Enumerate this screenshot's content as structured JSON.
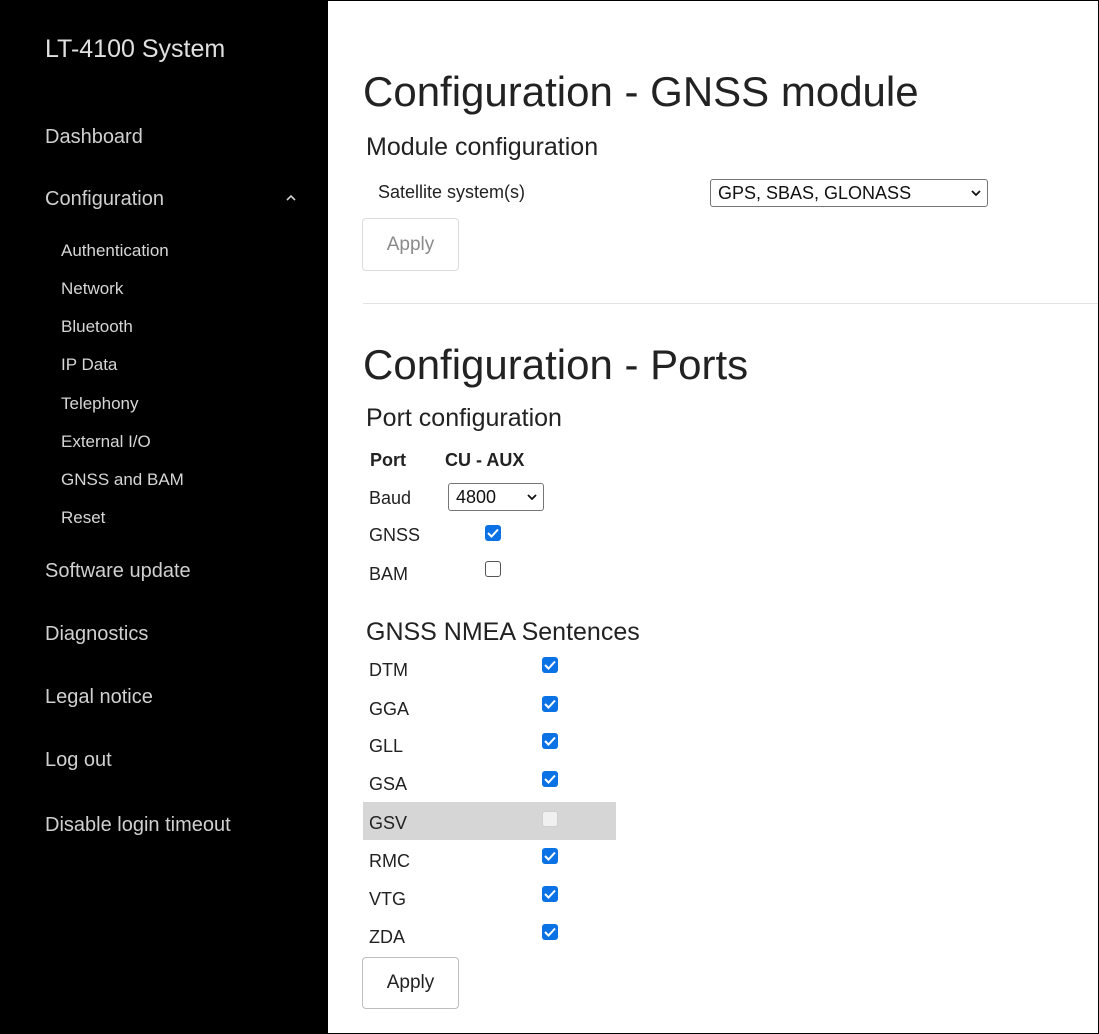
{
  "sidebar": {
    "brand": "LT-4100 System",
    "items": {
      "dashboard": "Dashboard",
      "configuration": "Configuration",
      "software_update": "Software update",
      "diagnostics": "Diagnostics",
      "legal_notice": "Legal notice",
      "log_out": "Log out",
      "disable_login_timeout": "Disable login timeout"
    },
    "config_sub": {
      "authentication": "Authentication",
      "network": "Network",
      "bluetooth": "Bluetooth",
      "ip_data": "IP Data",
      "telephony": "Telephony",
      "external_io": "External I/O",
      "gnss_bam": "GNSS and BAM",
      "reset": "Reset"
    },
    "expanded_icon": "chevron-up-icon"
  },
  "gnss": {
    "title": "Configuration - GNSS module",
    "section": "Module configuration",
    "satellite_label": "Satellite system(s)",
    "satellite_value": "GPS, SBAS, GLONASS",
    "apply": "Apply"
  },
  "ports": {
    "title": "Configuration - Ports",
    "section": "Port configuration",
    "header_port": "Port",
    "header_cu_aux": "CU - AUX",
    "baud_label": "Baud",
    "baud_value": "4800",
    "gnss_label": "GNSS",
    "gnss_checked": true,
    "bam_label": "BAM",
    "bam_checked": false
  },
  "nmea": {
    "title": "GNSS NMEA Sentences",
    "sentences": {
      "dtm": "DTM",
      "gga": "GGA",
      "gll": "GLL",
      "gsa": "GSA",
      "gsv": "GSV",
      "rmc": "RMC",
      "vtg": "VTG",
      "zda": "ZDA"
    },
    "checked": {
      "dtm": true,
      "gga": true,
      "gll": true,
      "gsa": true,
      "gsv": false,
      "rmc": true,
      "vtg": true,
      "zda": true
    },
    "gsv_disabled": true,
    "apply": "Apply"
  },
  "colors": {
    "sidebar_bg": "#000000",
    "checkbox_accent": "#0b72e6",
    "highlight_row": "#d6d6d6"
  }
}
